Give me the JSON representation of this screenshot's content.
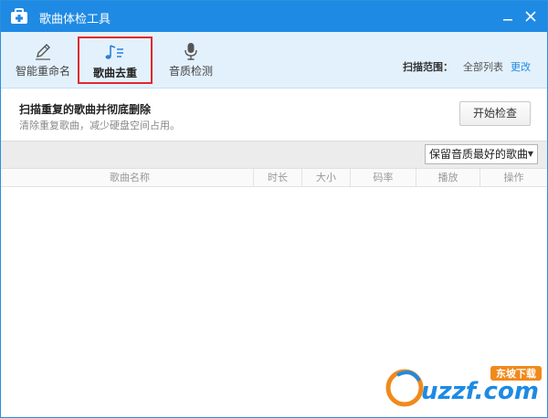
{
  "window": {
    "title": "歌曲体检工具"
  },
  "toolbar": {
    "tools": [
      {
        "label": "智能重命名",
        "icon": "pencil-icon"
      },
      {
        "label": "歌曲去重",
        "icon": "music-note-icon",
        "active": true
      },
      {
        "label": "音质检测",
        "icon": "microphone-icon"
      }
    ],
    "scan_label": "扫描范围：",
    "scan_value": "全部列表",
    "scan_change": "更改"
  },
  "info": {
    "title": "扫描重复的歌曲并彻底删除",
    "subtitle": "清除重复歌曲，减少硬盘空间占用。",
    "start_button": "开始检查"
  },
  "filter": {
    "selected": "保留音质最好的歌曲"
  },
  "table": {
    "columns": [
      "歌曲名称",
      "时长",
      "大小",
      "码率",
      "播放",
      "操作"
    ],
    "rows": []
  },
  "watermark": {
    "text": "uzzf.com",
    "badge": "东坡下载"
  },
  "colors": {
    "titlebar": "#1f8ae3",
    "toolbar_bg": "#e3f1fc",
    "active_border": "#e0292f",
    "link": "#1f8ae3"
  }
}
